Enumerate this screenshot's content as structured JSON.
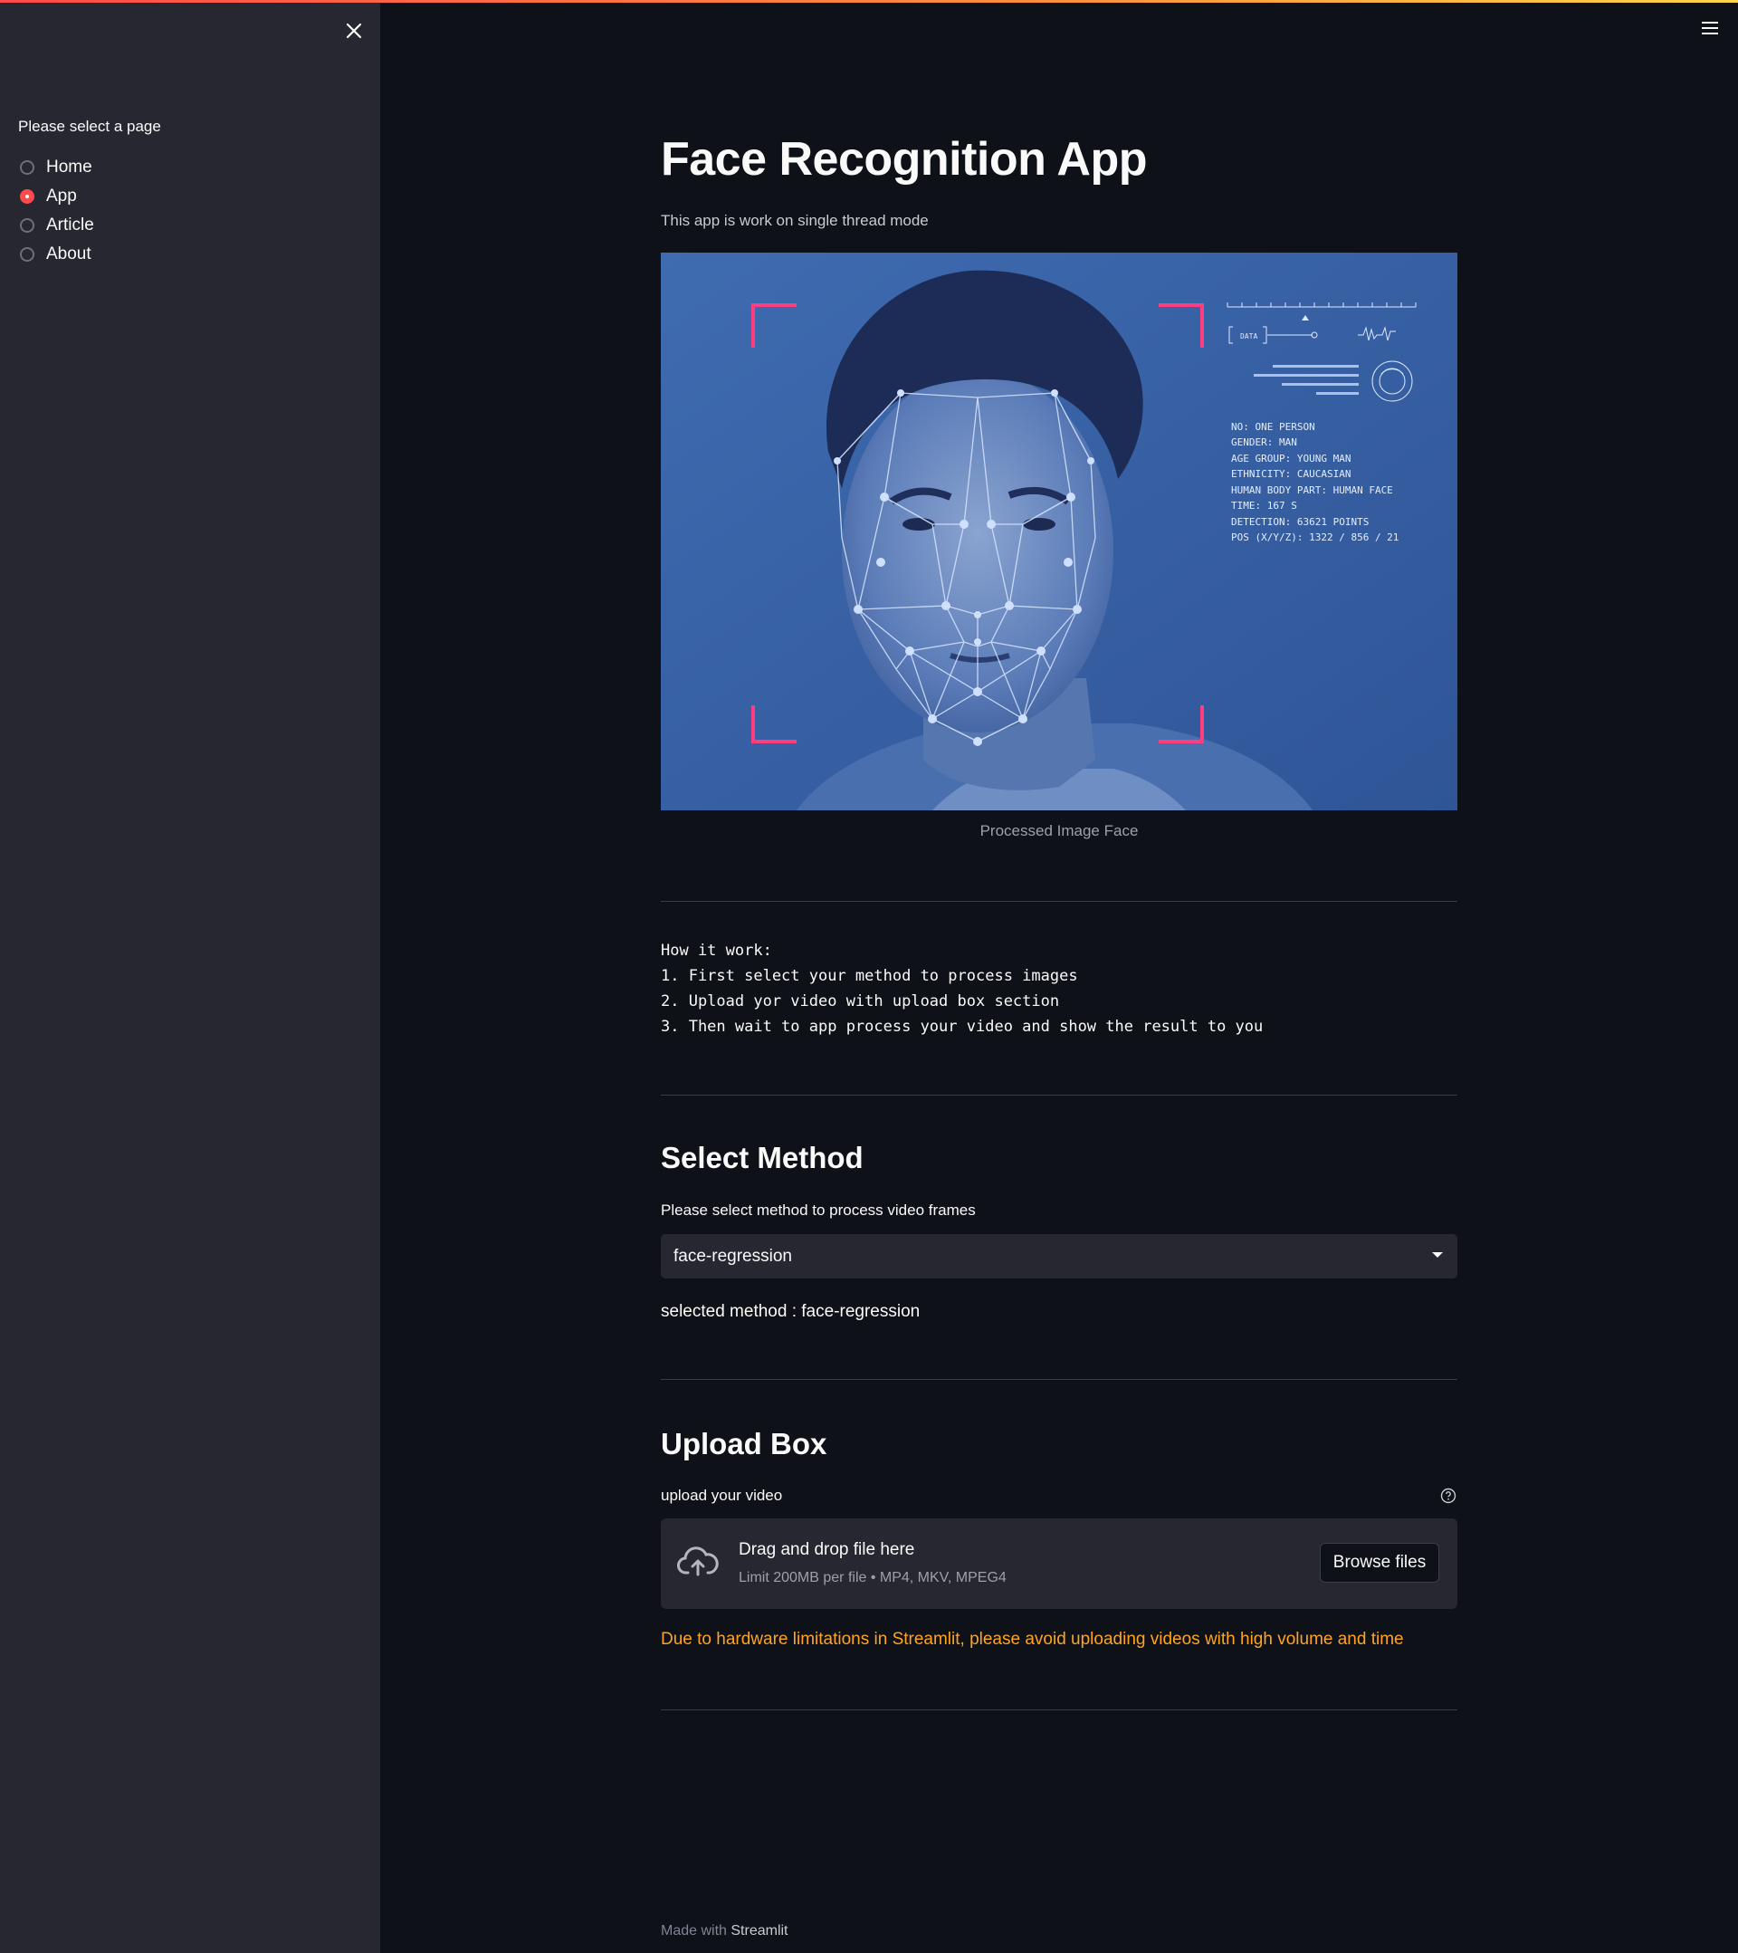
{
  "sidebar": {
    "radio_label": "Please select a page",
    "pages": [
      {
        "label": "Home",
        "selected": false
      },
      {
        "label": "App",
        "selected": true
      },
      {
        "label": "Article",
        "selected": false
      },
      {
        "label": "About",
        "selected": false
      }
    ],
    "close_icon": "close-icon"
  },
  "header": {
    "menu_icon": "hamburger-menu-icon"
  },
  "main": {
    "title": "Face Recognition App",
    "subtitle": "This app is work on single thread mode",
    "image_caption": "Processed Image Face",
    "hero_overlay": {
      "data_tag": "DATA",
      "lines": [
        "NO: ONE PERSON",
        "GENDER: MAN",
        "AGE GROUP: YOUNG MAN",
        "ETHNICITY: CAUCASIAN",
        "HUMAN BODY PART: HUMAN FACE",
        "TIME: 167 S",
        "DETECTION: 63621 POINTS",
        "POS (X/Y/Z): 1322 / 856 / 21"
      ]
    },
    "how_it_works": "How it work:\n1. First select your method to process images\n2. Upload yor video with upload box section\n3. Then wait to app process your video and show the result to you",
    "select_method": {
      "heading": "Select Method",
      "label": "Please select method to process video frames",
      "value": "face-regression",
      "selected_text": "selected method : face-regression"
    },
    "upload": {
      "heading": "Upload Box",
      "label": "upload your video",
      "drop_title": "Drag and drop file here",
      "drop_limit": "Limit 200MB per file • MP4, MKV, MPEG4",
      "browse_label": "Browse files",
      "warning": "Due to hardware limitations in Streamlit, please avoid uploading videos with high volume and time"
    },
    "footer": {
      "prefix": "Made with",
      "brand": "Streamlit"
    }
  },
  "colors": {
    "background": "#0e1117",
    "sidebar": "#262730",
    "accent": "#ff4b4b",
    "warning": "#ffa421",
    "hero_blue": "#3a66a8"
  }
}
